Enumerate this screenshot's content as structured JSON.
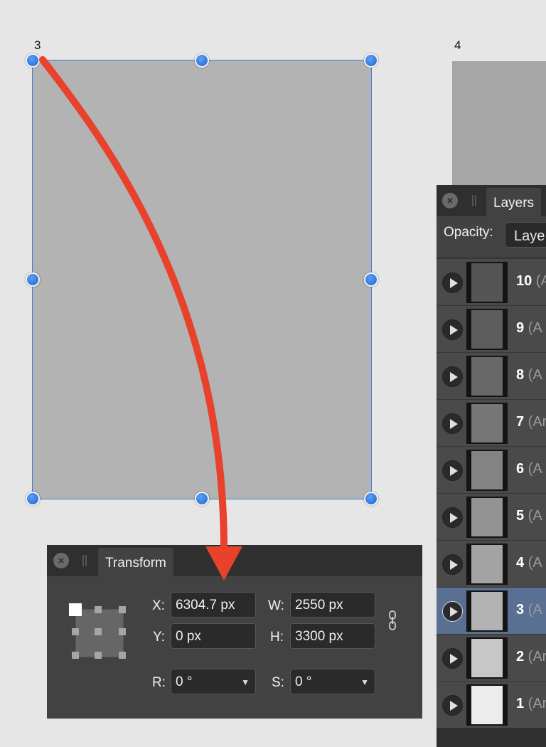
{
  "canvas": {
    "artboard_3_label": "3",
    "artboard_4_label": "4"
  },
  "layers_panel": {
    "tab_label": "Layers",
    "opacity_label": "Opacity:",
    "opacity_field_value": "Laye",
    "layers": [
      {
        "number": "10",
        "type": " (A",
        "shade": "#555555",
        "selected": false
      },
      {
        "number": "9",
        "type": " (A",
        "shade": "#5d5d5d",
        "selected": false
      },
      {
        "number": "8",
        "type": " (A",
        "shade": "#686868",
        "selected": false
      },
      {
        "number": "7",
        "type": " (Ar",
        "shade": "#767676",
        "selected": false
      },
      {
        "number": "6",
        "type": " (A",
        "shade": "#838383",
        "selected": false
      },
      {
        "number": "5",
        "type": " (A",
        "shade": "#939393",
        "selected": false
      },
      {
        "number": "4",
        "type": " (A",
        "shade": "#a3a3a3",
        "selected": false
      },
      {
        "number": "3",
        "type": " (A",
        "shade": "#b3b3b3",
        "selected": true
      },
      {
        "number": "2",
        "type": " (Ar",
        "shade": "#c7c7c7",
        "selected": false
      },
      {
        "number": "1",
        "type": " (Ar",
        "shade": "#ececec",
        "selected": false
      }
    ]
  },
  "transform_panel": {
    "tab_label": "Transform",
    "x_label": "X:",
    "x_value": "6304.7 px",
    "y_label": "Y:",
    "y_value": "0 px",
    "w_label": "W:",
    "w_value": "2550 px",
    "h_label": "H:",
    "h_value": "3300 px",
    "r_label": "R:",
    "r_value": "0 °",
    "s_label": "S:",
    "s_value": "0 °"
  },
  "colors": {
    "selection_blue": "#3f7fd6",
    "annotation_arrow": "#e8412c",
    "panel_bg": "#424242",
    "selected_row": "#5a7093"
  }
}
